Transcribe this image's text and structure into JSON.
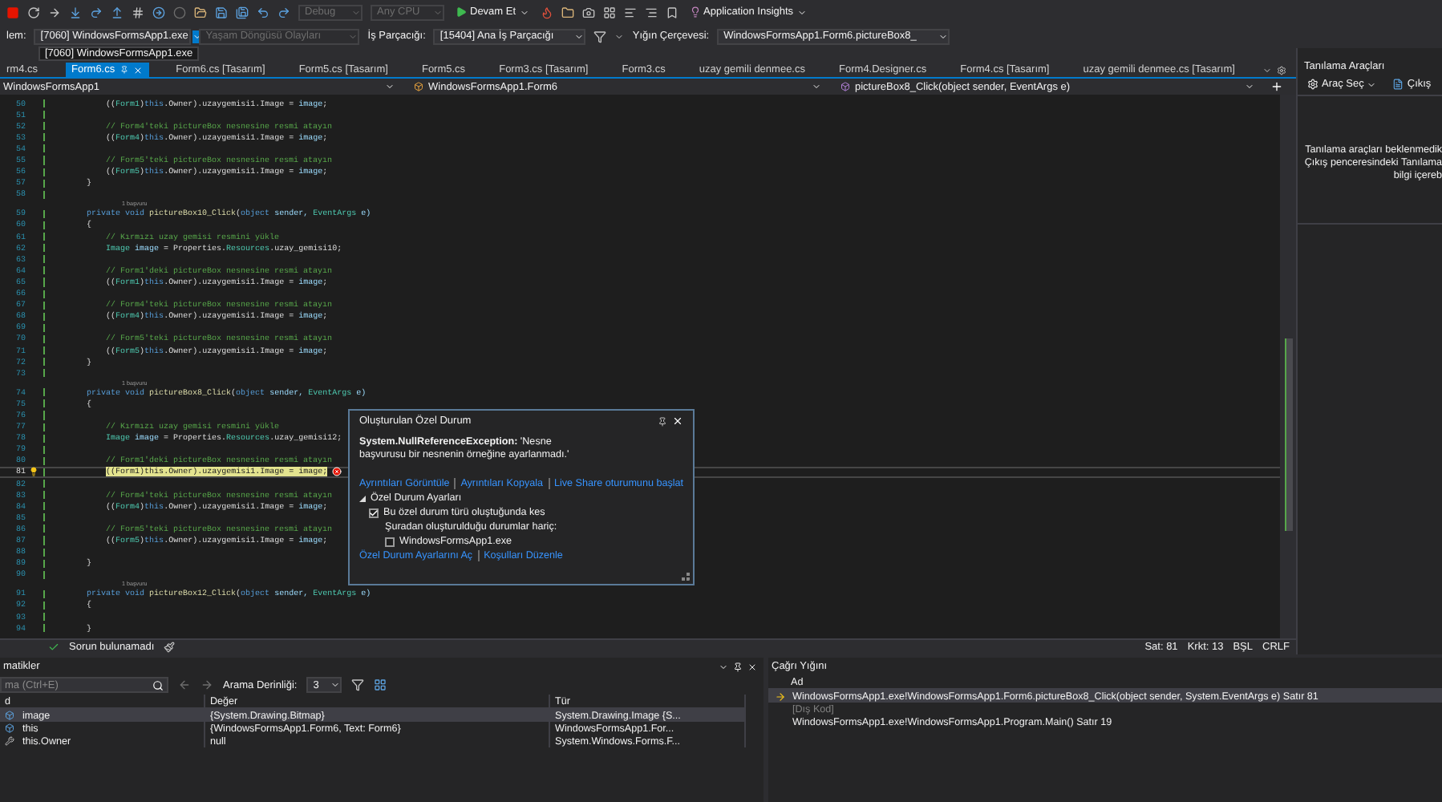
{
  "toolbar": {
    "configuration": {
      "value": "Debug",
      "disabled": true
    },
    "platform": {
      "value": "Any CPU",
      "disabled": true
    },
    "continue_button": "Devam Et",
    "insights_button": "Application Insights"
  },
  "debug_location": {
    "process_label": "lem:",
    "process": "[7060] WindowsFormsApp1.exe",
    "process_dropdown_open": true,
    "process_options": [
      "[7060] WindowsFormsApp1.exe"
    ],
    "lifecycle_events": {
      "label": "Yaşam Döngüsü Olayları",
      "disabled": true
    },
    "thread_label": "İş Parçacığı:",
    "thread": "[15404] Ana İş Parçacığı",
    "stack_frame_label": "Yığın Çerçevesi:",
    "stack_frame": "WindowsFormsApp1.Form6.pictureBox8_"
  },
  "tabs": [
    {
      "label": "rm4.cs",
      "selected": false
    },
    {
      "label": "Form6.cs",
      "selected": true
    },
    {
      "label": "Form6.cs [Tasarım]",
      "selected": false
    },
    {
      "label": "Form5.cs [Tasarım]",
      "selected": false
    },
    {
      "label": "Form5.cs",
      "selected": false
    },
    {
      "label": "Form3.cs [Tasarım]",
      "selected": false
    },
    {
      "label": "Form3.cs",
      "selected": false
    },
    {
      "label": "uzay gemili denmee.cs",
      "selected": false
    },
    {
      "label": "Form4.Designer.cs",
      "selected": false
    },
    {
      "label": "Form4.cs [Tasarım]",
      "selected": false
    },
    {
      "label": "uzay gemili denmee.cs [Tasarım]",
      "selected": false
    }
  ],
  "navigation": {
    "project": "WindowsFormsApp1",
    "class": "WindowsFormsApp1.Form6",
    "member": "pictureBox8_Click(object sender, EventArgs e)"
  },
  "code": {
    "lines": [
      {
        "kind": "code",
        "number": "50",
        "current": false,
        "segments": [
          {
            "text": "            ((",
            "kind": "plain"
          },
          {
            "text": "Form1",
            "kind": "type"
          },
          {
            "text": ")",
            "kind": "plain"
          },
          {
            "text": "this",
            "kind": "keyword"
          },
          {
            "text": ".Owner).uzaygemisi1.Image = ",
            "kind": "plain"
          },
          {
            "text": "image",
            "kind": "variable"
          },
          {
            "text": ";",
            "kind": "plain"
          }
        ]
      },
      {
        "kind": "code",
        "number": "51",
        "current": false
      },
      {
        "kind": "code",
        "number": "52",
        "current": false,
        "segments": [
          {
            "text": "            // Form4'teki pictureBox nesnesine resmi atayın",
            "kind": "comment"
          }
        ]
      },
      {
        "kind": "code",
        "number": "53",
        "current": false,
        "segments": [
          {
            "text": "            ((",
            "kind": "plain"
          },
          {
            "text": "Form4",
            "kind": "type"
          },
          {
            "text": ")",
            "kind": "plain"
          },
          {
            "text": "this",
            "kind": "keyword"
          },
          {
            "text": ".Owner).uzaygemisi1.Image = ",
            "kind": "plain"
          },
          {
            "text": "image",
            "kind": "variable"
          },
          {
            "text": ";",
            "kind": "plain"
          }
        ]
      },
      {
        "kind": "code",
        "number": "54",
        "current": false
      },
      {
        "kind": "code",
        "number": "55",
        "current": false,
        "segments": [
          {
            "text": "            // Form5'teki pictureBox nesnesine resmi atayın",
            "kind": "comment"
          }
        ]
      },
      {
        "kind": "code",
        "number": "56",
        "current": false,
        "segments": [
          {
            "text": "            ((",
            "kind": "plain"
          },
          {
            "text": "Form5",
            "kind": "type"
          },
          {
            "text": ")",
            "kind": "plain"
          },
          {
            "text": "this",
            "kind": "keyword"
          },
          {
            "text": ".Owner).uzaygemisi1.Image = ",
            "kind": "plain"
          },
          {
            "text": "image",
            "kind": "variable"
          },
          {
            "text": ";",
            "kind": "plain"
          }
        ]
      },
      {
        "kind": "code",
        "number": "57",
        "current": false,
        "segments": [
          {
            "text": "        }",
            "kind": "plain"
          }
        ]
      },
      {
        "kind": "code",
        "number": "58",
        "current": false
      },
      {
        "kind": "codelens",
        "text": "1 başvuru"
      },
      {
        "kind": "code",
        "number": "59",
        "current": false,
        "segments": [
          {
            "text": "        private void ",
            "kind": "keyword"
          },
          {
            "text": "pictureBox10_Click",
            "kind": "method"
          },
          {
            "text": "(",
            "kind": "plain"
          },
          {
            "text": "object",
            "kind": "keyword"
          },
          {
            "text": " sender, ",
            "kind": "variable"
          },
          {
            "text": "EventArgs",
            "kind": "type"
          },
          {
            "text": " e)",
            "kind": "variable"
          }
        ]
      },
      {
        "kind": "code",
        "number": "60",
        "current": false,
        "segments": [
          {
            "text": "        {",
            "kind": "plain"
          }
        ]
      },
      {
        "kind": "code",
        "number": "61",
        "current": false,
        "segments": [
          {
            "text": "            // Kırmızı uzay gemisi resmini yükle",
            "kind": "comment"
          }
        ]
      },
      {
        "kind": "code",
        "number": "62",
        "current": false,
        "segments": [
          {
            "text": "            Image",
            "kind": "type"
          },
          {
            "text": " image",
            "kind": "variable"
          },
          {
            "text": " = Properties.",
            "kind": "plain"
          },
          {
            "text": "Resources",
            "kind": "type"
          },
          {
            "text": ".uzay_gemisi10;",
            "kind": "plain"
          }
        ]
      },
      {
        "kind": "code",
        "number": "63",
        "current": false
      },
      {
        "kind": "code",
        "number": "64",
        "current": false,
        "segments": [
          {
            "text": "            // Form1'deki pictureBox nesnesine resmi atayın",
            "kind": "comment"
          }
        ]
      },
      {
        "kind": "code",
        "number": "65",
        "current": false,
        "segments": [
          {
            "text": "            ((",
            "kind": "plain"
          },
          {
            "text": "Form1",
            "kind": "type"
          },
          {
            "text": ")",
            "kind": "plain"
          },
          {
            "text": "this",
            "kind": "keyword"
          },
          {
            "text": ".Owner).uzaygemisi1.Image = ",
            "kind": "plain"
          },
          {
            "text": "image",
            "kind": "variable"
          },
          {
            "text": ";",
            "kind": "plain"
          }
        ]
      },
      {
        "kind": "code",
        "number": "66",
        "current": false
      },
      {
        "kind": "code",
        "number": "67",
        "current": false,
        "segments": [
          {
            "text": "            // Form4'teki pictureBox nesnesine resmi atayın",
            "kind": "comment"
          }
        ]
      },
      {
        "kind": "code",
        "number": "68",
        "current": false,
        "segments": [
          {
            "text": "            ((",
            "kind": "plain"
          },
          {
            "text": "Form4",
            "kind": "type"
          },
          {
            "text": ")",
            "kind": "plain"
          },
          {
            "text": "this",
            "kind": "keyword"
          },
          {
            "text": ".Owner).uzaygemisi1.Image = ",
            "kind": "plain"
          },
          {
            "text": "image",
            "kind": "variable"
          },
          {
            "text": ";",
            "kind": "plain"
          }
        ]
      },
      {
        "kind": "code",
        "number": "69",
        "current": false
      },
      {
        "kind": "code",
        "number": "70",
        "current": false,
        "segments": [
          {
            "text": "            // Form5'teki pictureBox nesnesine resmi atayın",
            "kind": "comment"
          }
        ]
      },
      {
        "kind": "code",
        "number": "71",
        "current": false,
        "segments": [
          {
            "text": "            ((",
            "kind": "plain"
          },
          {
            "text": "Form5",
            "kind": "type"
          },
          {
            "text": ")",
            "kind": "plain"
          },
          {
            "text": "this",
            "kind": "keyword"
          },
          {
            "text": ".Owner).uzaygemisi1.Image = ",
            "kind": "plain"
          },
          {
            "text": "image",
            "kind": "variable"
          },
          {
            "text": ";",
            "kind": "plain"
          }
        ]
      },
      {
        "kind": "code",
        "number": "72",
        "current": false,
        "segments": [
          {
            "text": "        }",
            "kind": "plain"
          }
        ]
      },
      {
        "kind": "code",
        "number": "73",
        "current": false
      },
      {
        "kind": "codelens",
        "text": "1 başvuru"
      },
      {
        "kind": "code",
        "number": "74",
        "current": false,
        "segments": [
          {
            "text": "        private void ",
            "kind": "keyword"
          },
          {
            "text": "pictureBox8_Click",
            "kind": "method"
          },
          {
            "text": "(",
            "kind": "plain"
          },
          {
            "text": "object",
            "kind": "keyword"
          },
          {
            "text": " sender, ",
            "kind": "variable"
          },
          {
            "text": "EventArgs",
            "kind": "type"
          },
          {
            "text": " e)",
            "kind": "variable"
          }
        ]
      },
      {
        "kind": "code",
        "number": "75",
        "current": false,
        "segments": [
          {
            "text": "        {",
            "kind": "plain"
          }
        ]
      },
      {
        "kind": "code",
        "number": "76",
        "current": false
      },
      {
        "kind": "code",
        "number": "77",
        "current": false,
        "segments": [
          {
            "text": "            // Kırmızı uzay gemisi resmini yükle",
            "kind": "comment"
          }
        ]
      },
      {
        "kind": "code",
        "number": "78",
        "current": false,
        "segments": [
          {
            "text": "            Image",
            "kind": "type"
          },
          {
            "text": " image",
            "kind": "variable"
          },
          {
            "text": " = Properties.",
            "kind": "plain"
          },
          {
            "text": "Resources",
            "kind": "type"
          },
          {
            "text": ".uzay_gemisi12;",
            "kind": "plain"
          }
        ]
      },
      {
        "kind": "code",
        "number": "79",
        "current": false
      },
      {
        "kind": "code",
        "number": "80",
        "current": false,
        "segments": [
          {
            "text": "            // Form1'deki pictureBox nesnesine resmi atayın",
            "kind": "comment"
          }
        ]
      },
      {
        "kind": "code",
        "number": "81",
        "current": true,
        "segments": [
          {
            "text": "((",
            "kind": "plain"
          },
          {
            "text": "Form1",
            "kind": "type"
          },
          {
            "text": ")",
            "kind": "plain"
          },
          {
            "text": "this",
            "kind": "keyword"
          },
          {
            "text": ".Owner).uzaygemisi1.Image = ",
            "kind": "plain"
          },
          {
            "text": "image",
            "kind": "variable"
          },
          {
            "text": ";",
            "kind": "plain"
          }
        ]
      },
      {
        "kind": "code",
        "number": "82",
        "current": false
      },
      {
        "kind": "code",
        "number": "83",
        "current": false,
        "segments": [
          {
            "text": "            // Form4'teki pictureBox nesnesine resmi atayın",
            "kind": "comment"
          }
        ]
      },
      {
        "kind": "code",
        "number": "84",
        "current": false,
        "segments": [
          {
            "text": "            ((",
            "kind": "plain"
          },
          {
            "text": "Form4",
            "kind": "type"
          },
          {
            "text": ")",
            "kind": "plain"
          },
          {
            "text": "this",
            "kind": "keyword"
          },
          {
            "text": ".Owner).uzaygemisi1.Image = ",
            "kind": "plain"
          },
          {
            "text": "image",
            "kind": "variable"
          },
          {
            "text": ";",
            "kind": "plain"
          }
        ]
      },
      {
        "kind": "code",
        "number": "85",
        "current": false
      },
      {
        "kind": "code",
        "number": "86",
        "current": false,
        "segments": [
          {
            "text": "            // Form5'teki pictureBox nesnesine resmi atayın",
            "kind": "comment"
          }
        ]
      },
      {
        "kind": "code",
        "number": "87",
        "current": false,
        "segments": [
          {
            "text": "            ((",
            "kind": "plain"
          },
          {
            "text": "Form5",
            "kind": "type"
          },
          {
            "text": ")",
            "kind": "plain"
          },
          {
            "text": "this",
            "kind": "keyword"
          },
          {
            "text": ".Owner).uzaygemisi1.Image = ",
            "kind": "plain"
          },
          {
            "text": "image",
            "kind": "variable"
          },
          {
            "text": ";",
            "kind": "plain"
          }
        ]
      },
      {
        "kind": "code",
        "number": "88",
        "current": false
      },
      {
        "kind": "code",
        "number": "89",
        "current": false,
        "segments": [
          {
            "text": "        }",
            "kind": "plain"
          }
        ]
      },
      {
        "kind": "code",
        "number": "90",
        "current": false
      },
      {
        "kind": "codelens",
        "text": "1 başvuru"
      },
      {
        "kind": "code",
        "number": "91",
        "current": false,
        "segments": [
          {
            "text": "        private void ",
            "kind": "keyword"
          },
          {
            "text": "pictureBox12_Click",
            "kind": "method"
          },
          {
            "text": "(",
            "kind": "plain"
          },
          {
            "text": "object",
            "kind": "keyword"
          },
          {
            "text": " sender, ",
            "kind": "variable"
          },
          {
            "text": "EventArgs",
            "kind": "type"
          },
          {
            "text": " e)",
            "kind": "variable"
          }
        ]
      },
      {
        "kind": "code",
        "number": "92",
        "current": false,
        "segments": [
          {
            "text": "        {",
            "kind": "plain"
          }
        ]
      },
      {
        "kind": "code",
        "number": "93",
        "current": false
      },
      {
        "kind": "code",
        "number": "94",
        "current": false,
        "segments": [
          {
            "text": "        }",
            "kind": "plain"
          }
        ]
      }
    ]
  },
  "exception_popup": {
    "title": "Oluşturulan Özel Durum",
    "message": "**System.NullReferenceException:** 'Nesne başvurusu bir nesnenin örneğine ayarlanmadı.'",
    "links": [
      "Ayrıntıları Görüntüle",
      "Ayrıntıları Kopyala",
      "Live Share oturumunu başlat"
    ],
    "settings": {
      "title": "Özel Durum Ayarları",
      "expanded": true,
      "break_option": {
        "label": "Bu özel durum türü oluştuğunda kes",
        "checked": true
      },
      "except_label": "Şuradan oluşturulduğu durumlar hariç:",
      "except_option": {
        "label": "WindowsFormsApp1.exe",
        "checked": false
      }
    },
    "footer_links": [
      "Özel Durum Ayarlarını Aç",
      "Koşulları Düzenle"
    ]
  },
  "status_bar": {
    "issues": "Sorun bulunamadı",
    "line": "Sat: 81",
    "column": "Krkt: 13",
    "insert_mode": "BŞL",
    "line_ending": "CRLF"
  },
  "diagnostics": {
    "title": "Tanılama Araçları",
    "select_tools": "Araç Seç",
    "output_button": "Çıkış",
    "message_lines": [
      "Tanılama araçları beklenmedik",
      "Çıkış penceresindeki Tanılama",
      "bilgi içereb"
    ]
  },
  "locals": {
    "title": "matikler",
    "search": {
      "placeholder": "ma (Ctrl+E)"
    },
    "depth_label": "Arama Derinliği:",
    "depth": "3",
    "columns": [
      "d",
      "Değer",
      "Tür"
    ],
    "rows": [
      {
        "name": "image",
        "value": "{System.Drawing.Bitmap}",
        "type": "System.Drawing.Image {S...",
        "kind": "object",
        "selected": true
      },
      {
        "name": "this",
        "value": "{WindowsFormsApp1.Form6, Text: Form6}",
        "type": "WindowsFormsApp1.For...",
        "kind": "object",
        "selected": false
      },
      {
        "name": "this.Owner",
        "value": "null",
        "type": "System.Windows.Forms.F...",
        "kind": "property",
        "selected": false
      }
    ]
  },
  "call_stack": {
    "title": "Çağrı Yığını",
    "columns": [
      "Ad"
    ],
    "frames": [
      {
        "text": "WindowsFormsApp1.exe!WindowsFormsApp1.Form6.pictureBox8_Click(object sender, System.EventArgs e) Satır 81",
        "current": true,
        "external": false
      },
      {
        "text": "[Dış Kod]",
        "current": false,
        "external": true
      },
      {
        "text": "WindowsFormsApp1.exe!WindowsFormsApp1.Program.Main() Satır 19",
        "current": false,
        "external": false
      }
    ]
  }
}
